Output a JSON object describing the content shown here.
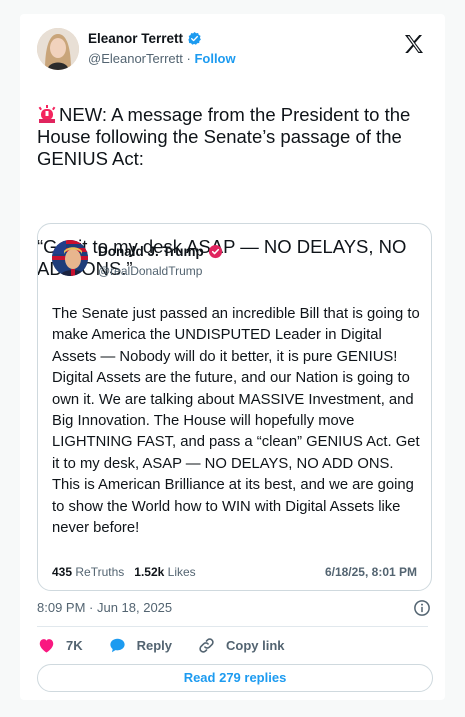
{
  "author": {
    "name": "Eleanor Terrett",
    "handle": "@EleanorTerrett",
    "separator": "·",
    "follow_label": "Follow"
  },
  "tweet": {
    "text_line1": "NEW: A message from the President to the House following the Senate’s passage of the GENIUS Act:",
    "text_quote": "“Get it to my desk ASAP — NO DELAYS, NO ADD ONS.”",
    "timestamp": "8:09 PM · Jun 18, 2025"
  },
  "quoted": {
    "name": "Donald J. Trump",
    "handle": "@realDonaldTrump",
    "body": "The Senate just passed an incredible Bill that is going to make America the UNDISPUTED Leader in Digital Assets — Nobody will do it better, it is pure GENIUS! Digital Assets are the future, and our Nation is going to own it. We are talking about MASSIVE Investment, and Big Innovation. The House will hopefully move LIGHTNING FAST, and pass a “clean” GENIUS Act. Get it to my desk, ASAP — NO DELAYS, NO ADD ONS. This is American Brilliance at its best, and we are going to show the World how to WIN with Digital Assets like never before!",
    "retruths_count": "435",
    "retruths_label": "ReTruths",
    "likes_count": "1.52k",
    "likes_label": "Likes",
    "date": "6/18/25, 8:01 PM"
  },
  "actions": {
    "like_count": "7K",
    "reply_label": "Reply",
    "copy_link_label": "Copy link"
  },
  "read_replies_label": "Read 279 replies",
  "colors": {
    "accent": "#1d9bf0",
    "like": "#f91880",
    "truth_badge": "#e0245e"
  },
  "icons": [
    "siren-icon",
    "verified-icon",
    "x-logo-icon",
    "info-icon",
    "heart-icon",
    "reply-icon",
    "link-icon"
  ]
}
